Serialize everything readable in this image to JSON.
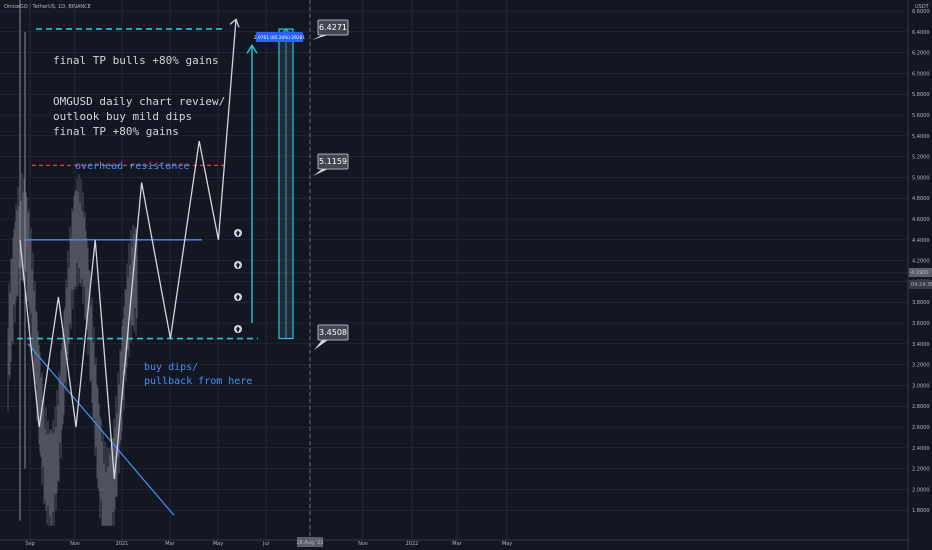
{
  "header": {
    "pair": "OmiseGO / TetherUS, 1D, BINANCE",
    "currency": "USDT"
  },
  "colors": {
    "background": "#131722",
    "grid": "#2a2e39",
    "price_line": "#9598a1",
    "cyan": "#26c6da",
    "blue": "#2962ff",
    "blue_text": "#4c8df6",
    "red": "#f23645",
    "text": "#b2b5be",
    "label_gray": "#5d606b"
  },
  "chart_data": {
    "type": "line",
    "title": "",
    "xlabel": "",
    "ylabel": "",
    "ylim": [
      1.6,
      6.8
    ],
    "x_ticks": [
      "Sep",
      "Nov",
      "2021",
      "Mar",
      "May",
      "Jul",
      "26 Aug '21",
      "Nov",
      "2022",
      "Mar",
      "May"
    ],
    "y_ticks": [
      "6.6000",
      "6.4000",
      "6.2000",
      "6.0000",
      "5.8000",
      "5.6000",
      "5.4000",
      "5.2000",
      "5.0000",
      "4.8000",
      "4.6000",
      "4.4000",
      "4.2000",
      "4.0000",
      "3.8000",
      "3.6000",
      "3.4000",
      "3.2000",
      "3.0000",
      "2.8000",
      "2.6000",
      "2.4000",
      "2.2000",
      "2.0000",
      "1.8000"
    ],
    "current_price": "4.1900",
    "countdown": "04:24:36",
    "projection_path": {
      "name": "projected path",
      "points": [
        [
          4.4,
          0
        ],
        [
          2.6,
          12
        ],
        [
          3.85,
          24
        ],
        [
          2.6,
          35
        ],
        [
          4.4,
          47
        ],
        [
          2.1,
          59
        ],
        [
          4.95,
          76
        ],
        [
          3.45,
          94
        ],
        [
          5.35,
          112
        ],
        [
          4.4,
          124
        ],
        [
          6.52,
          135
        ]
      ]
    },
    "levels": [
      {
        "id": "tp",
        "value": 6.4271,
        "label": "6.4271",
        "style": "cyan-dashed"
      },
      {
        "id": "resistance",
        "value": 5.1159,
        "label": "5.1159",
        "style": "red-dashed"
      },
      {
        "id": "buy",
        "value": 3.4508,
        "label": "3.4508",
        "style": "cyan-dashed"
      },
      {
        "id": "range",
        "value": 4.4,
        "label": "",
        "style": "blue-solid"
      }
    ],
    "measurement": {
      "label": "2.9761 (85.24%) 29261",
      "from": 3.4508,
      "to": 6.4271
    },
    "annotations": {
      "tp_note": "final TP bulls +80% gains",
      "review_lines": [
        "OMGUSD daily chart review/",
        "outlook buy mild dips",
        "final TP +80% gains"
      ],
      "resistance_note": "overhead resistance",
      "buy_lines": [
        "buy dips/",
        "pullback from here"
      ]
    }
  }
}
